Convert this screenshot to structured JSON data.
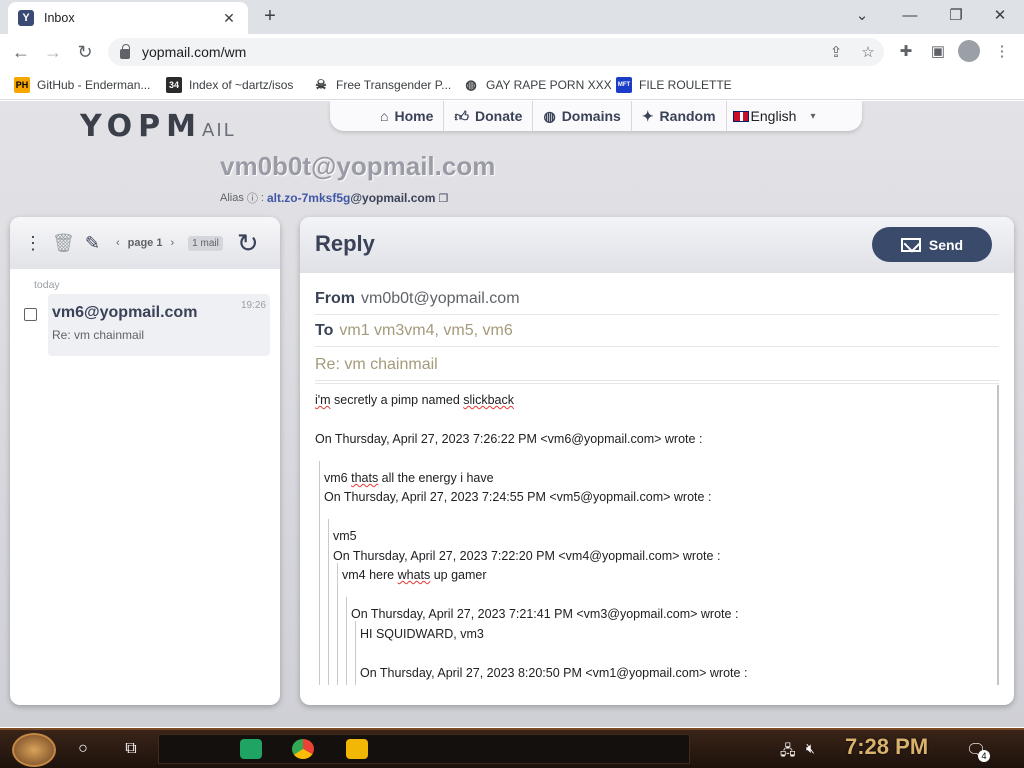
{
  "browser": {
    "tab_title": "Inbox",
    "tab_favicon": "Y",
    "url": "yopmail.com/wm",
    "bookmarks": [
      {
        "label": "GitHub - Enderman...",
        "icon": "PH",
        "icon_bg": "#f7a600"
      },
      {
        "label": "Index of ~dartz/isos",
        "icon": "34",
        "icon_bg": "#2b2b2b"
      },
      {
        "label": "Free Transgender P...",
        "icon": "skull-icon",
        "icon_bg": "#ffffff"
      },
      {
        "label": "GAY RAPE PORN XXX",
        "icon": "globe-icon",
        "icon_bg": "#ffffff"
      },
      {
        "label": "FILE ROULETTE",
        "icon": "MFT",
        "icon_bg": "#1a3cc8"
      }
    ]
  },
  "site": {
    "logo": "YOPMAIL",
    "nav": [
      {
        "label": "Home",
        "icon": "home-icon"
      },
      {
        "label": "Donate",
        "icon": "thumbs-up-icon"
      },
      {
        "label": "Domains",
        "icon": "globe-icon"
      },
      {
        "label": "Random",
        "icon": "magic-wand-icon"
      }
    ],
    "language": "English",
    "mailbox": "vm0b0t@yopmail.com",
    "alias_label": "Alias",
    "alias_value": "alt.zo-7mksf5g",
    "alias_domain": "@yopmail.com"
  },
  "inbox": {
    "page_label": "page 1",
    "count_label": "1 mail",
    "day_label": "today",
    "mails": [
      {
        "from": "vm6@yopmail.com",
        "subject": "Re: vm chainmail",
        "time": "19:26"
      }
    ]
  },
  "reply": {
    "title": "Reply",
    "send_label": "Send",
    "from_label": "From",
    "from_value": "vm0b0t@yopmail.com",
    "to_label": "To",
    "to_value": "vm1 vm3vm4, vm5, vm6",
    "subject_value": "Re: vm chainmail",
    "body": {
      "l1a": "i'm",
      "l1b": " secretly a pimp named ",
      "l1c": "slickback",
      "l2": "On Thursday, April 27, 2023 7:26:22 PM <vm6@yopmail.com> wrote :",
      "l3a": "vm6 ",
      "l3b": "thats",
      "l3c": " all the energy i have",
      "l4": "On Thursday, April 27, 2023 7:24:55 PM <vm5@yopmail.com> wrote :",
      "l5": "vm5",
      "l6": "On Thursday, April 27, 2023 7:22:20 PM <vm4@yopmail.com> wrote :",
      "l7a": "vm4 here ",
      "l7b": "whats",
      "l7c": " up gamer",
      "l8": "On Thursday, April 27, 2023 7:21:41 PM <vm3@yopmail.com> wrote :",
      "l9": "HI SQUIDWARD, vm3",
      "l10": "On Thursday, April 27, 2023 8:20:50 PM <vm1@yopmail.com> wrote :"
    }
  },
  "taskbar": {
    "clock": "7:28 PM",
    "notification_count": "4"
  }
}
